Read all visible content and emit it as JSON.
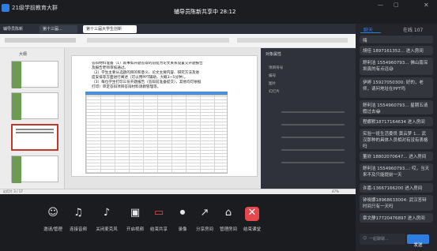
{
  "window": {
    "title": "21级学前教育大群"
  },
  "share_banner": "辅导员陈新共享中 28:12",
  "wps": {
    "app_label": "辅导员陈新",
    "tab1": "第十三届...",
    "tab2": "第十三届大学生创新"
  },
  "slides_panel": {
    "label": "大纲"
  },
  "document": {
    "para1": "答辩材料准备（1）叙事如开题答辩的前提为论文关系设置交开题报告",
    "para2": "及报告老师审核通过。",
    "para3": "（2）学生主要从选题的目的和意义、论文主要内容、研究方法及进",
    "para4": "度安排等方面进行阐述（可以用PPT辅助，大概3~5分钟）。",
    "para5": "（3）每位学生打印三份开题报告（答辩前准备提交），其他均可依据",
    "para6": "打印）审定答辩项目答辩材料请教管理等。"
  },
  "properties": {
    "title": "对象属性",
    "opt1": "项目符号",
    "opt2": "编号",
    "opt3": "图片",
    "opt4": "幻灯片"
  },
  "status": {
    "left": "幻灯片 3 / 17",
    "zoom": "47%"
  },
  "chat": {
    "tab_chat": "聊天",
    "tab_members": "在线 107",
    "messages": [
      {
        "text": "嗨"
      },
      {
        "text": "胡佳 1897161352... 进入房间"
      },
      {
        "text": "舒利洁 1554960793... 佛山南深圳真的有点远😅"
      },
      {
        "text": "伊婷 15927050300: 好的，老师，请问地址在PPT吗"
      },
      {
        "text": "舒利洁 1554960793... 星期五请假过去😂"
      },
      {
        "text": "程娜默18717164634 进入房间"
      },
      {
        "text": "实验一班生活委员 黄云梦 1... 武汉那种的具体人员相对有没有表格吗"
      },
      {
        "text": "董欣 18802070647... 进入房间"
      },
      {
        "text": "舒利洁 1554960793...: 哎，当天来不及只能提前一天"
      },
      {
        "text": "许嘉-13667166200 进入房间"
      },
      {
        "text": "钟晓娜18968633004: 武汉答辩时间只有一天吗"
      },
      {
        "text": "章文静17720476897 进入房间"
      }
    ],
    "input_placeholder": "一起聊聊...",
    "send_label": "发送"
  },
  "toolbar": {
    "members": "邀请/管理",
    "audio": "连接音频",
    "mute": "关闭麦克风",
    "video": "开启视频",
    "share": "结束共享",
    "record": "录像",
    "share_room": "分享房间",
    "manage": "管理房间",
    "leave": "结束课堂"
  },
  "colors": {
    "accent": "#2f7de1",
    "leave": "#e5484d",
    "chat_bg": "#23252b"
  }
}
